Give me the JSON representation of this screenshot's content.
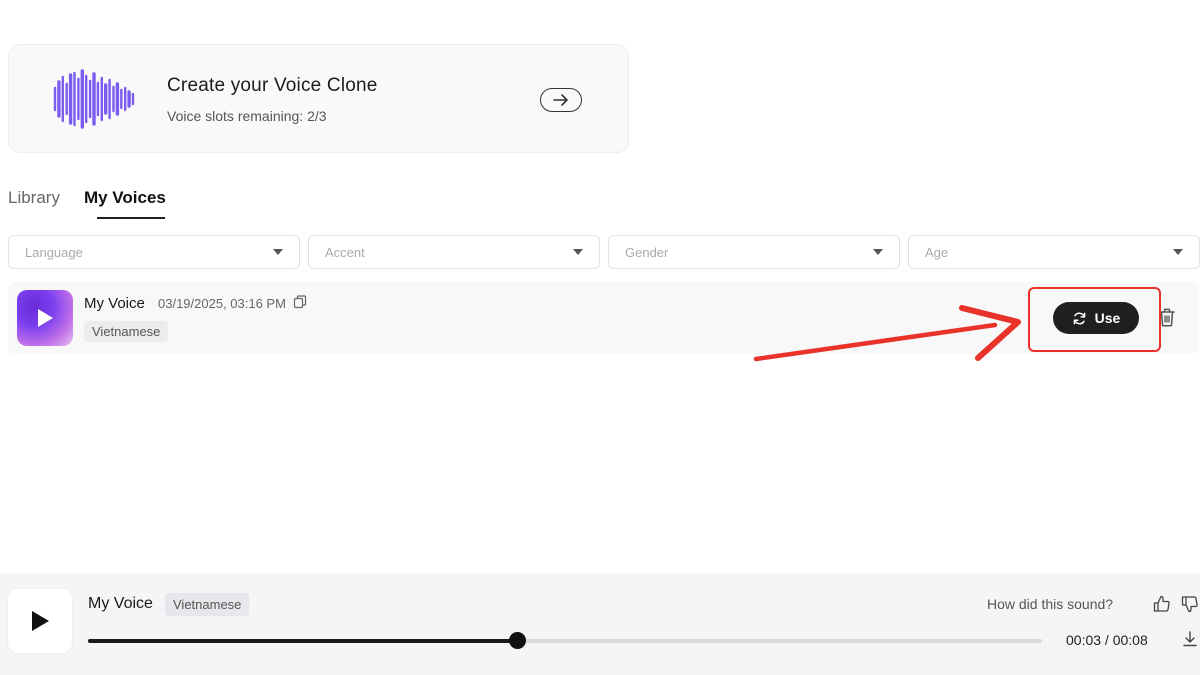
{
  "clone_card": {
    "title": "Create your Voice Clone",
    "slots_text": "Voice slots remaining: 2/3",
    "accent_color": "#7b5cf0"
  },
  "tabs": [
    {
      "label": "Library",
      "active": false
    },
    {
      "label": "My Voices",
      "active": true
    }
  ],
  "filters": [
    {
      "placeholder": "Language"
    },
    {
      "placeholder": "Accent"
    },
    {
      "placeholder": "Gender"
    },
    {
      "placeholder": "Age"
    }
  ],
  "voice": {
    "name": "My Voice",
    "date": "03/19/2025, 03:16 PM",
    "language_tag": "Vietnamese",
    "use_label": "Use"
  },
  "player": {
    "name": "My Voice",
    "tag": "Vietnamese",
    "feedback_prompt": "How did this sound?",
    "progress": 0.45,
    "time_text": "00:03 / 00:08"
  },
  "colors": {
    "annotation_red": "#e8322a",
    "dark": "#1f1f1f"
  },
  "icons": [
    "waveform-icon",
    "arrow-right-icon",
    "play-icon",
    "copy-icon",
    "refresh-icon",
    "trash-icon",
    "thumbs-up-icon",
    "thumbs-down-icon",
    "download-icon"
  ]
}
